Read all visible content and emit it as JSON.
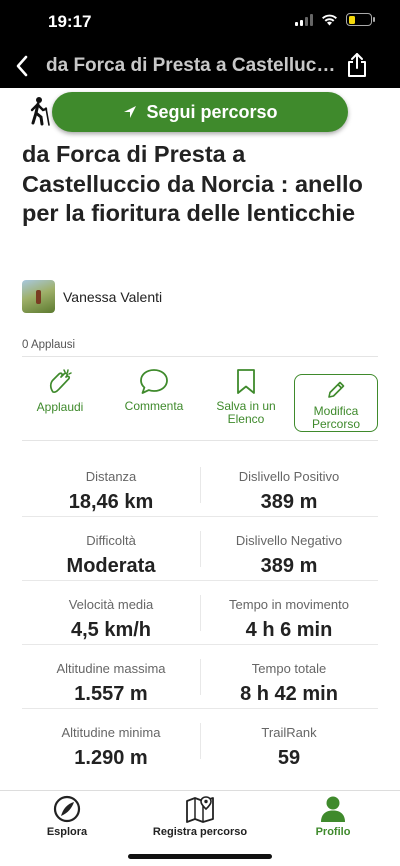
{
  "status_bar": {
    "time": "19:17",
    "battery_level": 0.3,
    "signal_bars": 2,
    "signal_bars_total": 4
  },
  "nav": {
    "title": "da Forca di Presta a Castelluccio da Norcia : anello per la fioritura delle lenticchie"
  },
  "follow_button": {
    "label": "Segui percorso"
  },
  "trail": {
    "title": "da Forca di Presta a Castelluccio da Norcia : anello per la fioritura delle lenticchie"
  },
  "author": {
    "name": "Vanessa Valenti"
  },
  "applause": {
    "text": "0 Applausi"
  },
  "actions": {
    "applaud": "Applaudi",
    "comment": "Commenta",
    "save": "Salva in un Elenco",
    "edit": "Modifica Percorso"
  },
  "stats": [
    {
      "left": {
        "label": "Distanza",
        "value": "18,46 km"
      },
      "right": {
        "label": "Dislivello Positivo",
        "value": "389 m"
      }
    },
    {
      "left": {
        "label": "Difficoltà",
        "value": "Moderata"
      },
      "right": {
        "label": "Dislivello Negativo",
        "value": "389 m"
      }
    },
    {
      "left": {
        "label": "Velocità media",
        "value": "4,5 km/h"
      },
      "right": {
        "label": "Tempo in movimento",
        "value": "4 h 6 min"
      }
    },
    {
      "left": {
        "label": "Altitudine massima",
        "value": "1.557 m"
      },
      "right": {
        "label": "Tempo totale",
        "value": "8 h 42 min"
      }
    },
    {
      "left": {
        "label": "Altitudine minima",
        "value": "1.290 m"
      },
      "right": {
        "label": "TrailRank",
        "value": "59"
      }
    }
  ],
  "tab_bar": {
    "explore": "Esplora",
    "record": "Registra percorso",
    "profile": "Profilo"
  },
  "colors": {
    "accent": "#3f8a2c",
    "text": "#222222",
    "muted": "#666666"
  }
}
